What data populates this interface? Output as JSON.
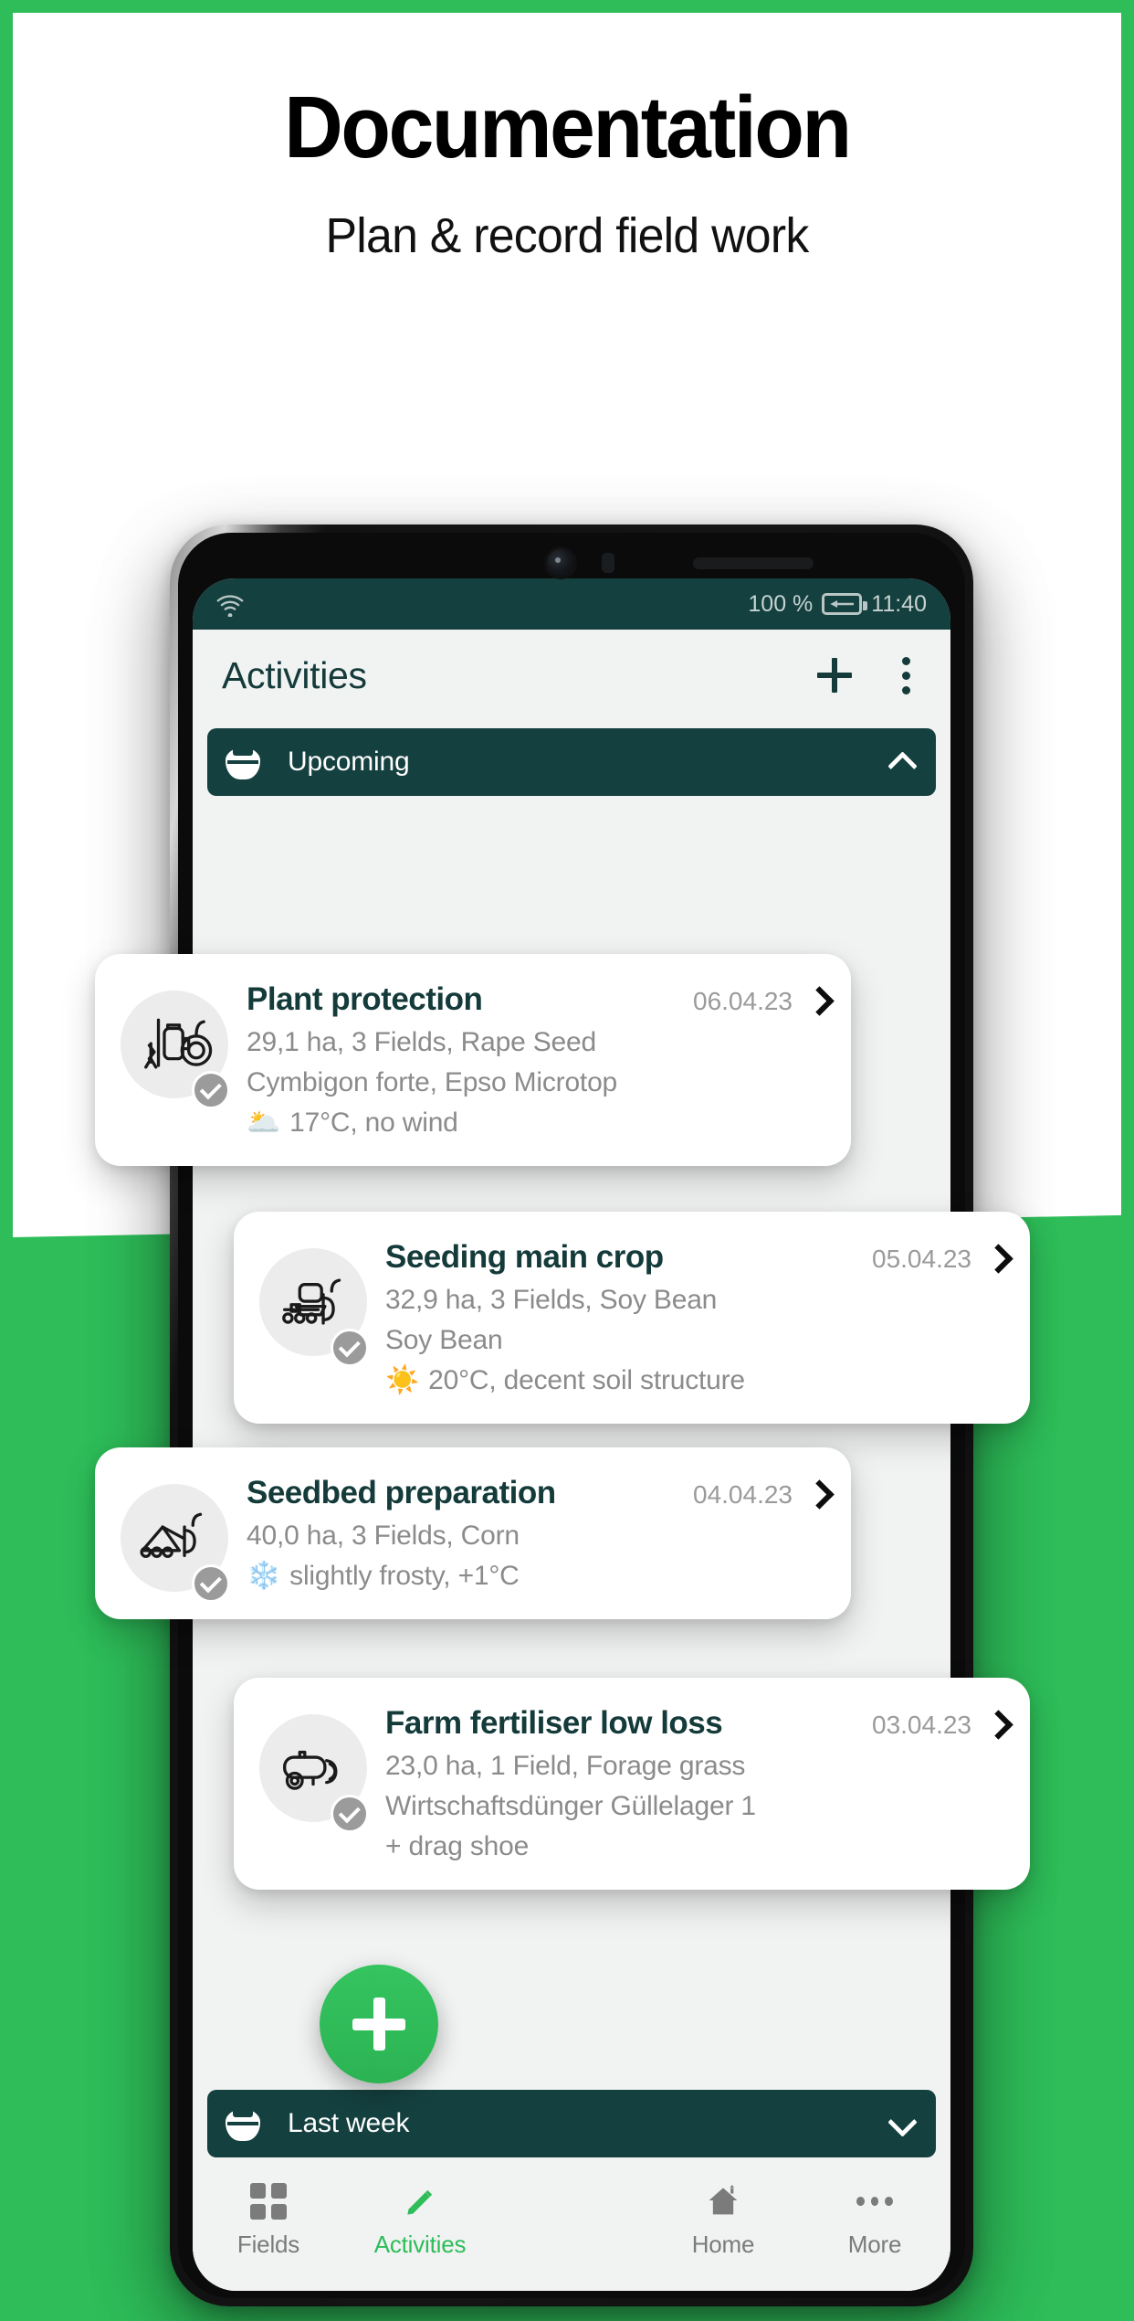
{
  "hero": {
    "title": "Documentation",
    "subtitle": "Plan & record field work"
  },
  "colors": {
    "brand_green": "#2ebd59",
    "dark_teal": "#14403f",
    "screen_bg": "#f1f2f2",
    "muted_text": "#8b8b8b"
  },
  "phone": {
    "status_bar": {
      "wifi_icon": "wifi-icon",
      "battery_percent": "100 %",
      "battery_icon": "battery-charging-icon",
      "time": "11:40"
    },
    "app_bar": {
      "title": "Activities",
      "add_icon": "plus-icon",
      "overflow_icon": "more-vertical-icon"
    },
    "sections": [
      {
        "icon": "calendar-icon",
        "label": "Upcoming",
        "chevron": "chevron-up-icon"
      },
      {
        "icon": "calendar-icon",
        "label": "Last week",
        "chevron": "chevron-down-icon"
      }
    ],
    "activities": [
      {
        "title": "Plant protection",
        "date": "06.04.23",
        "line1": "29,1 ha, 3 Fields, Rape Seed",
        "line2": "Cymbigon forte, Epso Microtop",
        "weather_icon": "🌥️",
        "weather": "17°C, no wind",
        "machine_icon": "field-sprayer-icon",
        "status_icon": "check-circle-icon",
        "arrow_icon": "chevron-right-icon"
      },
      {
        "title": "Seeding main crop",
        "date": "05.04.23",
        "line1": "32,9 ha, 3 Fields, Soy Bean",
        "line2": "Soy Bean",
        "weather_icon": "☀️",
        "weather": "20°C, decent soil structure",
        "machine_icon": "seed-drill-icon",
        "status_icon": "check-circle-icon",
        "arrow_icon": "chevron-right-icon"
      },
      {
        "title": "Seedbed preparation",
        "date": "04.04.23",
        "line1": "40,0 ha, 3 Fields, Corn",
        "line2": "",
        "weather_icon": "❄️",
        "weather": "slightly frosty, +1°C",
        "machine_icon": "cultivator-icon",
        "status_icon": "check-circle-icon",
        "arrow_icon": "chevron-right-icon"
      },
      {
        "title": "Farm fertiliser low loss",
        "date": "03.04.23",
        "line1": "23,0 ha, 1 Field, Forage grass",
        "line2": "Wirtschaftsdünger Güllelager 1",
        "line3": "+ drag shoe",
        "weather_icon": "",
        "weather": "",
        "machine_icon": "slurry-tanker-icon",
        "status_icon": "check-circle-icon",
        "arrow_icon": "chevron-right-icon"
      }
    ],
    "bottom_nav": {
      "items": [
        {
          "label": "Fields",
          "icon": "grid-icon",
          "active": false
        },
        {
          "label": "Activities",
          "icon": "pencil-icon",
          "active": true
        },
        {
          "label": "Home",
          "icon": "home-icon",
          "active": false
        },
        {
          "label": "More",
          "icon": "ellipsis-icon",
          "active": false
        }
      ],
      "fab_icon": "plus-icon"
    }
  }
}
